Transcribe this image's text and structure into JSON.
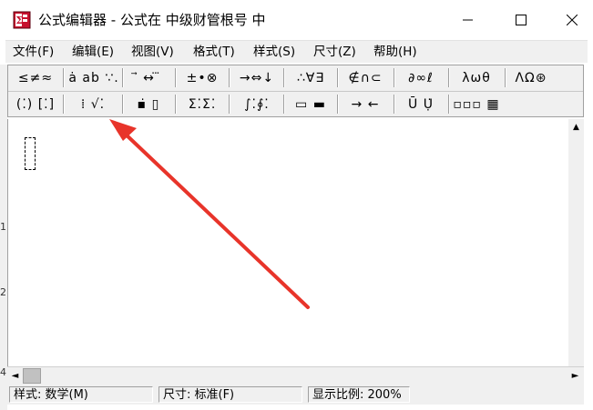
{
  "window": {
    "title": "公式编辑器 - 公式在 中级财管根号 中",
    "app_icon_label": "Σ",
    "controls": {
      "minimize": "minimize-icon",
      "maximize": "maximize-icon",
      "close": "close-icon"
    }
  },
  "menubar": {
    "items": [
      {
        "label": "文件(F)"
      },
      {
        "label": "编辑(E)"
      },
      {
        "label": "视图(V)"
      },
      {
        "label": "格式(T)"
      },
      {
        "label": "样式(S)"
      },
      {
        "label": "尺寸(Z)"
      },
      {
        "label": "帮助(H)"
      }
    ]
  },
  "toolbar": {
    "row1": [
      {
        "label": "≤≠≈"
      },
      {
        "label": "ȧ ab ∵."
      },
      {
        "label": "⃗ ↔ ⃛"
      },
      {
        "label": "±•⊗"
      },
      {
        "label": "→⇔↓"
      },
      {
        "label": "∴∀∃"
      },
      {
        "label": "∉∩⊂"
      },
      {
        "label": "∂∞ℓ"
      },
      {
        "label": "λωθ"
      },
      {
        "label": "ΛΩ⊛"
      }
    ],
    "row2": [
      {
        "label": "(⁚) [⁚]"
      },
      {
        "label": "⁞ √⁚"
      },
      {
        "label": "▪̇ ▯"
      },
      {
        "label": "Σ⁚Σ⁚"
      },
      {
        "label": "∫⁚∮⁚"
      },
      {
        "label": "▭ ▬"
      },
      {
        "label": "→ ←"
      },
      {
        "label": "Ū Ụ̇"
      },
      {
        "label": "▫▫▫ ▦"
      }
    ]
  },
  "statusbar": {
    "style_label": "样式: 数学(M)",
    "size_label": "尺寸: 标准(F)",
    "zoom_label": "显示比例: 200%"
  },
  "side_numbers": [
    "1",
    "2",
    "4"
  ],
  "scroll": {
    "left": "◄",
    "right": "►",
    "up": "▲"
  },
  "colors": {
    "annotation_arrow": "#e8342a",
    "chrome": "#f0f0f0"
  }
}
